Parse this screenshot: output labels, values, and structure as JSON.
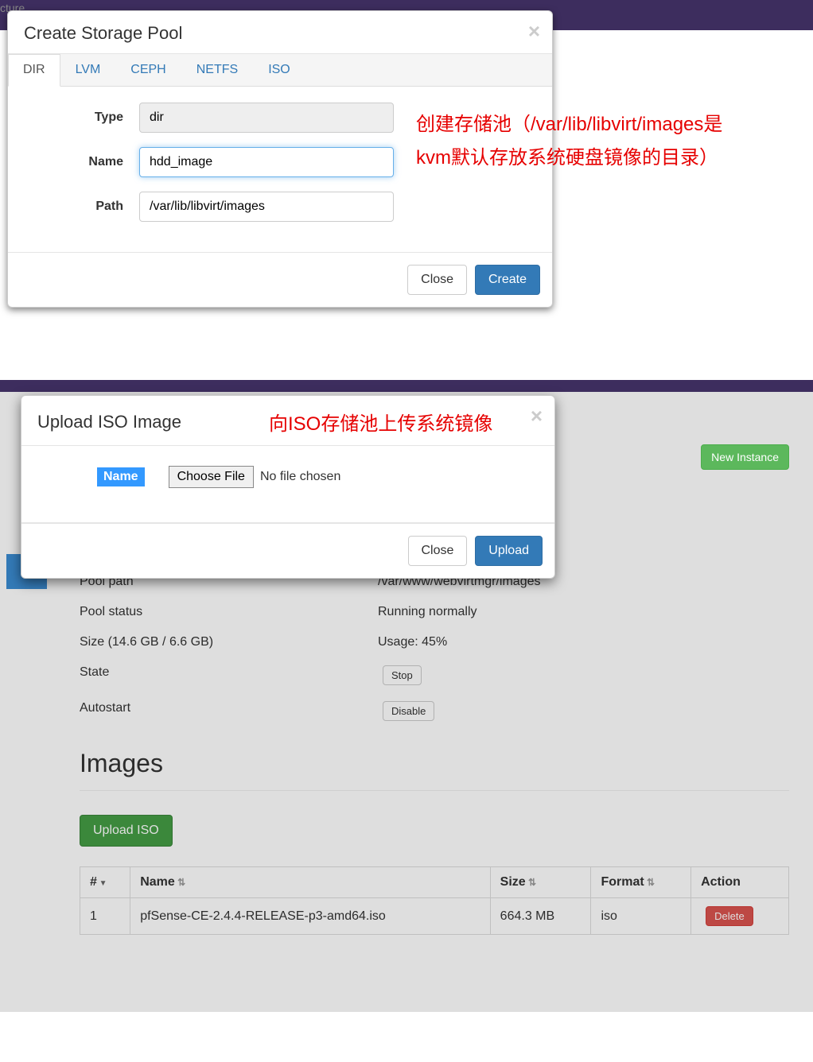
{
  "topbar_text": "cture",
  "modal1": {
    "title": "Create Storage Pool",
    "tabs": [
      "DIR",
      "LVM",
      "CEPH",
      "NETFS",
      "ISO"
    ],
    "fields": {
      "type_label": "Type",
      "type_value": "dir",
      "name_label": "Name",
      "name_value": "hdd_image",
      "path_label": "Path",
      "path_value": "/var/lib/libvirt/images"
    },
    "close": "Close",
    "create": "Create"
  },
  "annotation1": "创建存储池（/var/lib/libvirt/images是kvm默认存放系统硬盘镜像的目录）",
  "modal2": {
    "title": "Upload ISO Image",
    "annotation": "向ISO存储池上传系统镜像",
    "name_label": "Name",
    "choose_file": "Choose File",
    "no_file": "No file chosen",
    "close": "Close",
    "upload": "Upload"
  },
  "new_instance": "New Instance",
  "pool": {
    "path_label": "Pool path",
    "path_value": "/var/www/webvirtmgr/images",
    "status_label": "Pool status",
    "status_value": "Running normally",
    "size_label": "Size (14.6 GB / 6.6 GB)",
    "size_value": "Usage: 45%",
    "state_label": "State",
    "state_btn": "Stop",
    "autostart_label": "Autostart",
    "autostart_btn": "Disable"
  },
  "images": {
    "heading": "Images",
    "upload_btn": "Upload ISO",
    "cols": {
      "num": "#",
      "name": "Name",
      "size": "Size",
      "format": "Format",
      "action": "Action"
    },
    "rows": [
      {
        "num": "1",
        "name": "pfSense-CE-2.4.4-RELEASE-p3-amd64.iso",
        "size": "664.3 MB",
        "format": "iso",
        "delete": "Delete"
      }
    ]
  }
}
